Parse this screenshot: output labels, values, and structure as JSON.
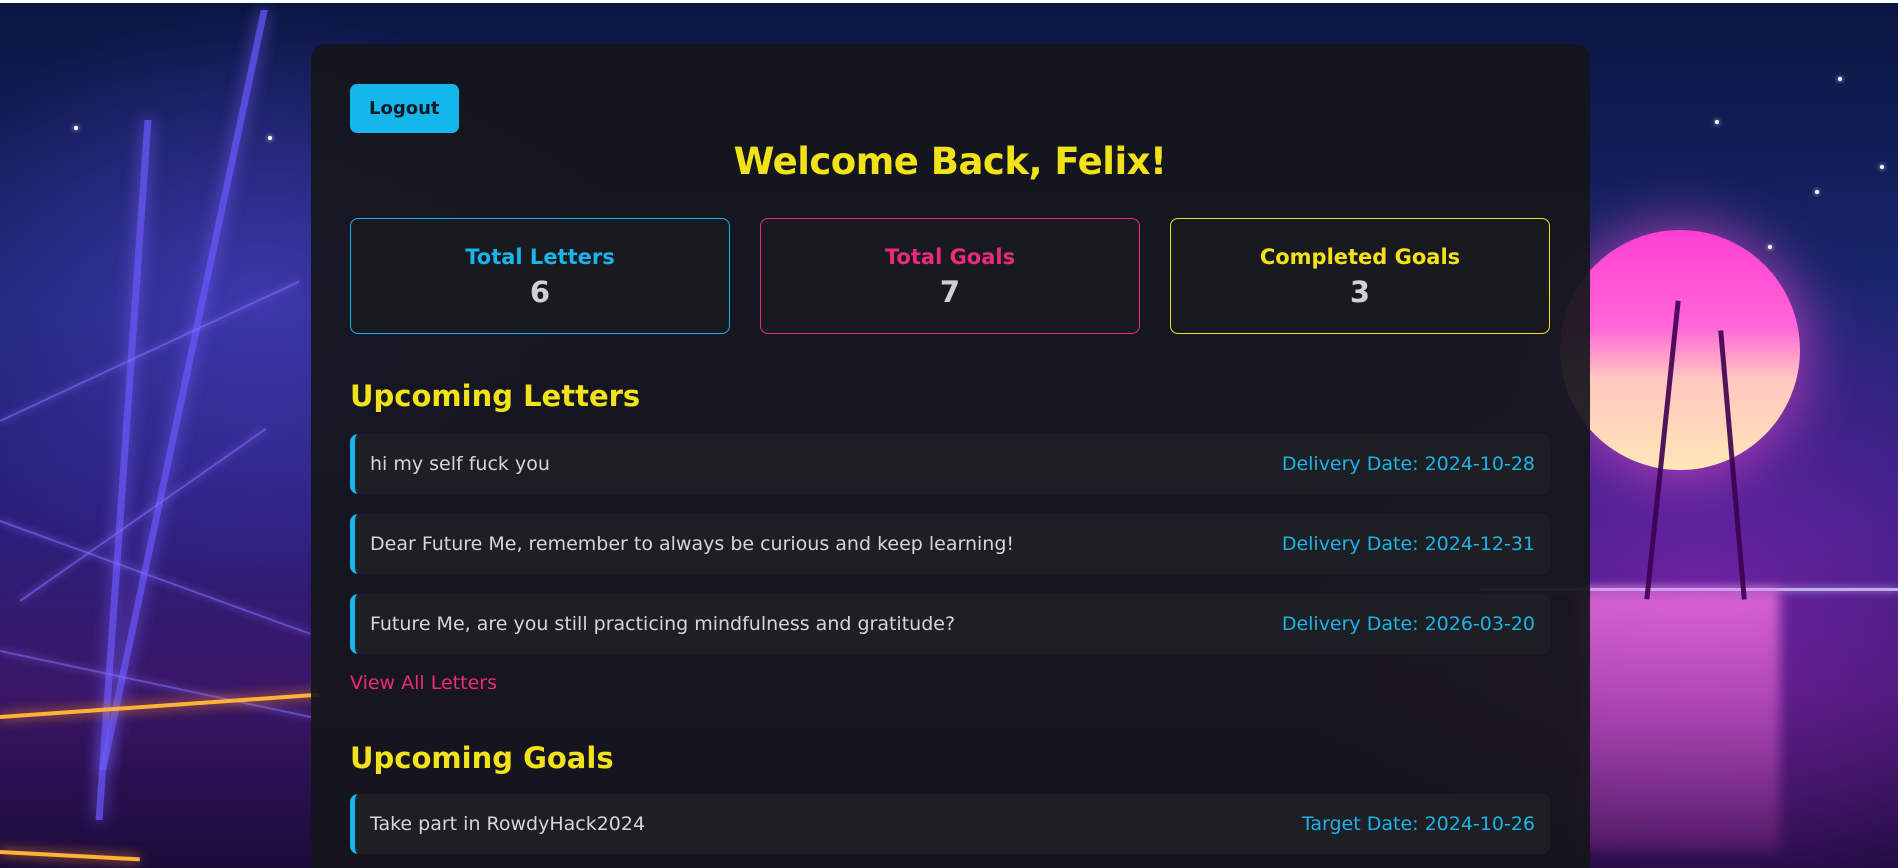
{
  "header": {
    "logout_label": "Logout",
    "welcome_title": "Welcome Back, Felix!"
  },
  "stats": [
    {
      "label": "Total Letters",
      "value": "6",
      "color": "#1ab4e8"
    },
    {
      "label": "Total Goals",
      "value": "7",
      "color": "#ea2b7a"
    },
    {
      "label": "Completed Goals",
      "value": "3",
      "color": "#f2e21a"
    }
  ],
  "letters": {
    "title": "Upcoming Letters",
    "items": [
      {
        "text": "hi my self fuck you",
        "date": "Delivery Date: 2024-10-28"
      },
      {
        "text": "Dear Future Me, remember to always be curious and keep learning!",
        "date": "Delivery Date: 2024-12-31"
      },
      {
        "text": "Future Me, are you still practicing mindfulness and gratitude?",
        "date": "Delivery Date: 2026-03-20"
      }
    ],
    "view_all_label": "View All Letters"
  },
  "goals": {
    "title": "Upcoming Goals",
    "items": [
      {
        "text": "Take part in RowdyHack2024",
        "date": "Target Date: 2024-10-26"
      }
    ]
  },
  "theme": {
    "accent_blue": "#1ab4e8",
    "accent_pink": "#ea2b7a",
    "accent_yellow": "#f2e21a",
    "panel_bg": "#14151b"
  }
}
